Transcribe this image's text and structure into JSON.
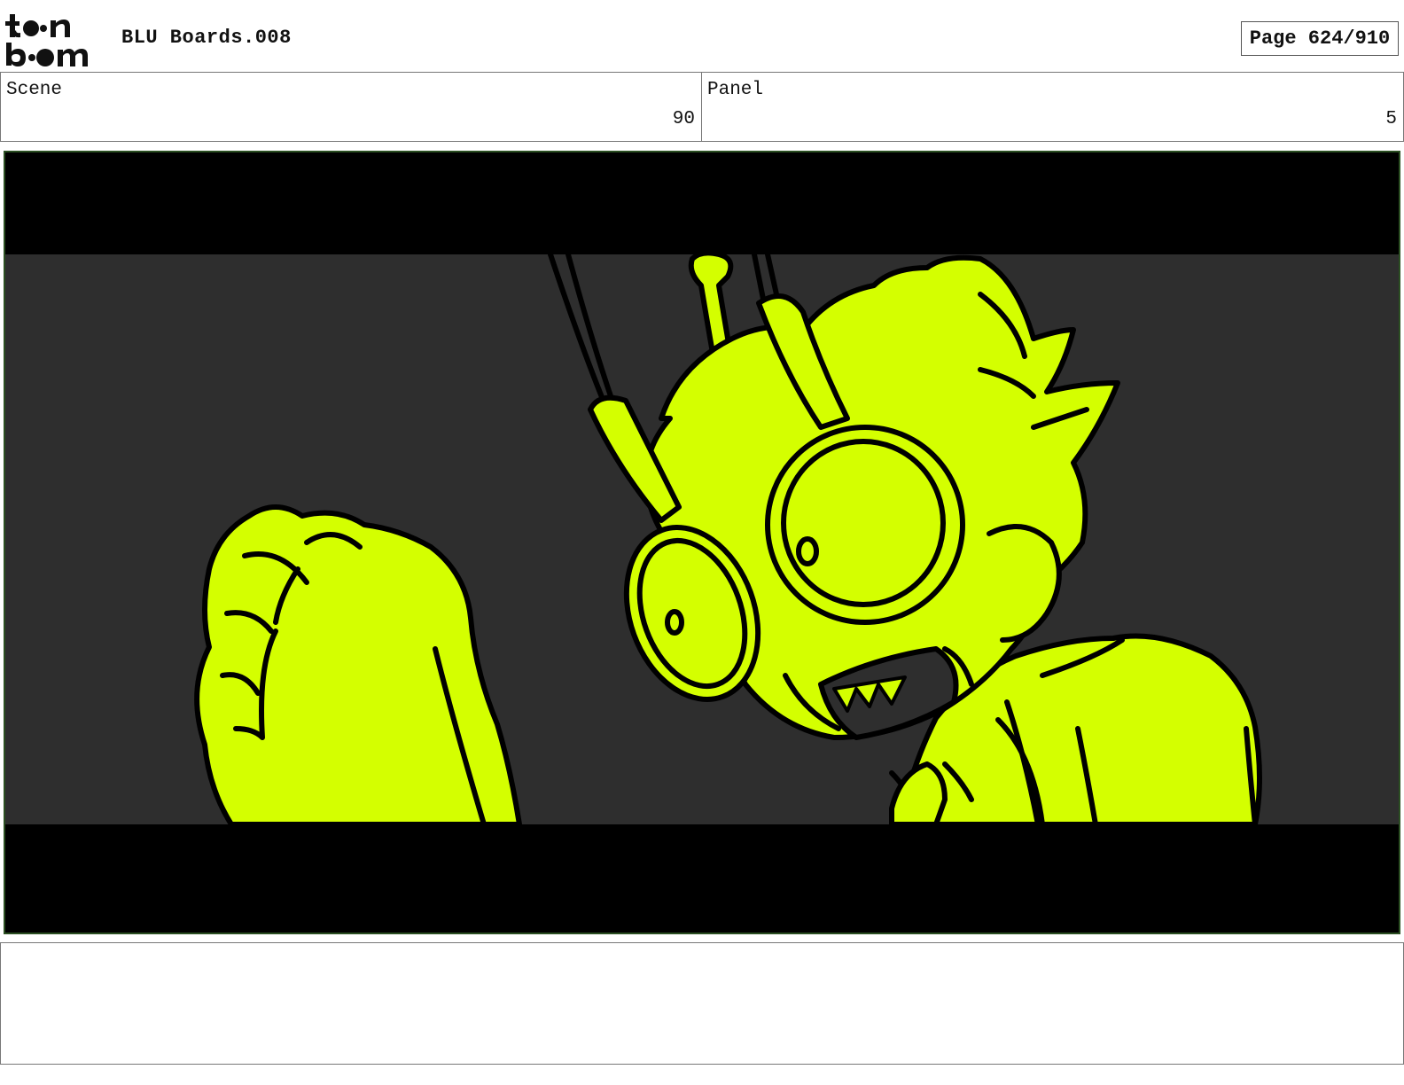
{
  "header": {
    "logo_alt": "toon boom",
    "title": "BLU Boards.008",
    "page": "Page 624/910"
  },
  "scene": {
    "label": "Scene",
    "value": "90"
  },
  "panel": {
    "label": "Panel",
    "value": "5"
  },
  "colors": {
    "sketch_fill": "#d4ff00",
    "background_fill": "#2e2e2e",
    "letterbox": "#000000",
    "frame_border": "#2b4f22"
  },
  "notes": {
    "text": ""
  }
}
